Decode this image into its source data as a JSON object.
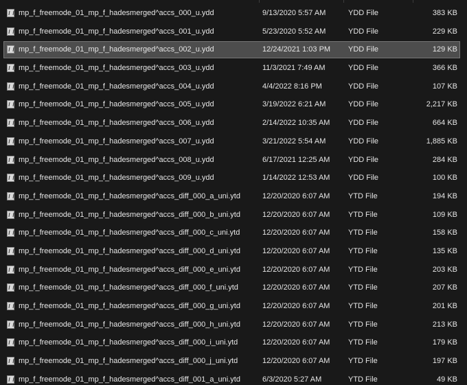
{
  "file_icon": "document-file-icon",
  "files": [
    {
      "name": "mp_f_freemode_01_mp_f_hadesmerged^accs_000_u.ydd",
      "date": "9/13/2020 5:57 AM",
      "type": "YDD File",
      "size": "383 KB",
      "selected": false
    },
    {
      "name": "mp_f_freemode_01_mp_f_hadesmerged^accs_001_u.ydd",
      "date": "5/23/2020 5:52 AM",
      "type": "YDD File",
      "size": "229 KB",
      "selected": false
    },
    {
      "name": "mp_f_freemode_01_mp_f_hadesmerged^accs_002_u.ydd",
      "date": "12/24/2021 1:03 PM",
      "type": "YDD File",
      "size": "129 KB",
      "selected": true
    },
    {
      "name": "mp_f_freemode_01_mp_f_hadesmerged^accs_003_u.ydd",
      "date": "11/3/2021 7:49 AM",
      "type": "YDD File",
      "size": "366 KB",
      "selected": false
    },
    {
      "name": "mp_f_freemode_01_mp_f_hadesmerged^accs_004_u.ydd",
      "date": "4/4/2022 8:16 PM",
      "type": "YDD File",
      "size": "107 KB",
      "selected": false
    },
    {
      "name": "mp_f_freemode_01_mp_f_hadesmerged^accs_005_u.ydd",
      "date": "3/19/2022 6:21 AM",
      "type": "YDD File",
      "size": "2,217 KB",
      "selected": false
    },
    {
      "name": "mp_f_freemode_01_mp_f_hadesmerged^accs_006_u.ydd",
      "date": "2/14/2022 10:35 AM",
      "type": "YDD File",
      "size": "664 KB",
      "selected": false
    },
    {
      "name": "mp_f_freemode_01_mp_f_hadesmerged^accs_007_u.ydd",
      "date": "3/21/2022 5:54 AM",
      "type": "YDD File",
      "size": "1,885 KB",
      "selected": false
    },
    {
      "name": "mp_f_freemode_01_mp_f_hadesmerged^accs_008_u.ydd",
      "date": "6/17/2021 12:25 AM",
      "type": "YDD File",
      "size": "284 KB",
      "selected": false
    },
    {
      "name": "mp_f_freemode_01_mp_f_hadesmerged^accs_009_u.ydd",
      "date": "1/14/2022 12:53 AM",
      "type": "YDD File",
      "size": "100 KB",
      "selected": false
    },
    {
      "name": "mp_f_freemode_01_mp_f_hadesmerged^accs_diff_000_a_uni.ytd",
      "date": "12/20/2020 6:07 AM",
      "type": "YTD File",
      "size": "194 KB",
      "selected": false
    },
    {
      "name": "mp_f_freemode_01_mp_f_hadesmerged^accs_diff_000_b_uni.ytd",
      "date": "12/20/2020 6:07 AM",
      "type": "YTD File",
      "size": "109 KB",
      "selected": false
    },
    {
      "name": "mp_f_freemode_01_mp_f_hadesmerged^accs_diff_000_c_uni.ytd",
      "date": "12/20/2020 6:07 AM",
      "type": "YTD File",
      "size": "158 KB",
      "selected": false
    },
    {
      "name": "mp_f_freemode_01_mp_f_hadesmerged^accs_diff_000_d_uni.ytd",
      "date": "12/20/2020 6:07 AM",
      "type": "YTD File",
      "size": "135 KB",
      "selected": false
    },
    {
      "name": "mp_f_freemode_01_mp_f_hadesmerged^accs_diff_000_e_uni.ytd",
      "date": "12/20/2020 6:07 AM",
      "type": "YTD File",
      "size": "203 KB",
      "selected": false
    },
    {
      "name": "mp_f_freemode_01_mp_f_hadesmerged^accs_diff_000_f_uni.ytd",
      "date": "12/20/2020 6:07 AM",
      "type": "YTD File",
      "size": "207 KB",
      "selected": false
    },
    {
      "name": "mp_f_freemode_01_mp_f_hadesmerged^accs_diff_000_g_uni.ytd",
      "date": "12/20/2020 6:07 AM",
      "type": "YTD File",
      "size": "201 KB",
      "selected": false
    },
    {
      "name": "mp_f_freemode_01_mp_f_hadesmerged^accs_diff_000_h_uni.ytd",
      "date": "12/20/2020 6:07 AM",
      "type": "YTD File",
      "size": "213 KB",
      "selected": false
    },
    {
      "name": "mp_f_freemode_01_mp_f_hadesmerged^accs_diff_000_i_uni.ytd",
      "date": "12/20/2020 6:07 AM",
      "type": "YTD File",
      "size": "179 KB",
      "selected": false
    },
    {
      "name": "mp_f_freemode_01_mp_f_hadesmerged^accs_diff_000_j_uni.ytd",
      "date": "12/20/2020 6:07 AM",
      "type": "YTD File",
      "size": "197 KB",
      "selected": false
    },
    {
      "name": "mp_f_freemode_01_mp_f_hadesmerged^accs_diff_001_a_uni.ytd",
      "date": "6/3/2020 5:27 AM",
      "type": "YTD File",
      "size": "49 KB",
      "selected": false
    }
  ]
}
